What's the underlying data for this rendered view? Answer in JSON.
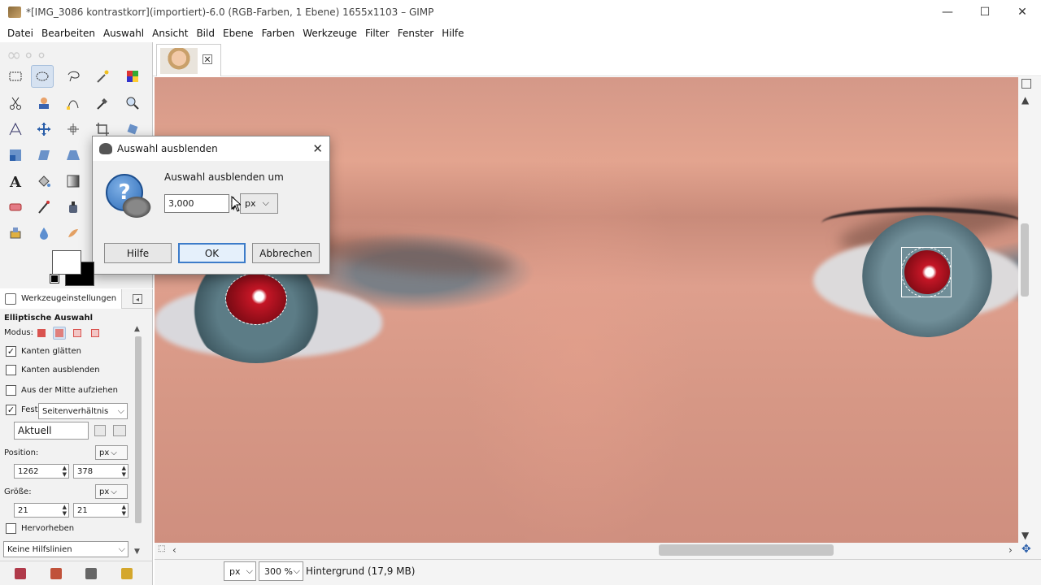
{
  "window": {
    "title": "*[IMG_3086 kontrastkorr](importiert)-6.0 (RGB-Farben, 1 Ebene) 1655x1103 – GIMP",
    "controls": {
      "minimize": "—",
      "maximize": "☐",
      "close": "✕"
    }
  },
  "menu": [
    {
      "label": "Datei"
    },
    {
      "label": "Bearbeiten"
    },
    {
      "label": "Auswahl"
    },
    {
      "label": "Ansicht"
    },
    {
      "label": "Bild"
    },
    {
      "label": "Ebene"
    },
    {
      "label": "Farben"
    },
    {
      "label": "Werkzeuge"
    },
    {
      "label": "Filter"
    },
    {
      "label": "Fenster"
    },
    {
      "label": "Hilfe"
    }
  ],
  "tools": [
    "rect-select-icon",
    "ellipse-select-icon",
    "lasso-icon",
    "fuzzy-select-icon",
    "color-select-icon",
    "scissors-icon",
    "foreground-select-icon",
    "paths-icon",
    "color-picker-icon",
    "zoom-icon",
    "measure-icon",
    "move-icon",
    "align-icon",
    "crop-icon",
    "rotate-icon",
    "scale-icon",
    "shear-icon",
    "perspective-icon",
    "flip-icon",
    "cage-icon",
    "text-icon",
    "bucket-fill-icon",
    "blend-icon",
    "pencil-icon",
    "paintbrush-icon",
    "eraser-icon",
    "airbrush-icon",
    "ink-icon",
    "clone-icon",
    "heal-icon",
    "stamp-icon",
    "blur-icon",
    "smudge-icon",
    "dodge-icon"
  ],
  "options": {
    "tab_label": "Werkzeugeinstellungen",
    "title": "Elliptische Auswahl",
    "mode_label": "Modus:",
    "antialias": {
      "label": "Kanten glätten",
      "checked": true
    },
    "feather": {
      "label": "Kanten ausblenden",
      "checked": false
    },
    "from_center": {
      "label": "Aus der Mitte aufziehen",
      "checked": false
    },
    "fixed": {
      "label": "Fest:",
      "checked": true,
      "value": "Seitenverhältnis"
    },
    "aspect_value": "Aktuell",
    "position_label": "Position:",
    "position_unit": "px",
    "position_x": "1262",
    "position_y": "378",
    "size_label": "Größe:",
    "size_unit": "px",
    "size_w": "21",
    "size_h": "21",
    "highlight": {
      "label": "Hervorheben",
      "checked": false
    },
    "guides": "Keine Hilfslinien"
  },
  "status": {
    "unit": "px",
    "zoom": "300 %",
    "layer_info": "Hintergrund (17,9 MB)"
  },
  "dialog": {
    "title": "Auswahl ausblenden",
    "prompt": "Auswahl ausblenden um",
    "value": "3,000",
    "unit": "px",
    "buttons": {
      "help": "Hilfe",
      "ok": "OK",
      "cancel": "Abbrechen"
    }
  },
  "colors": {
    "accent": "#3d7cc9",
    "selected_tool": "#d6e2f1"
  }
}
